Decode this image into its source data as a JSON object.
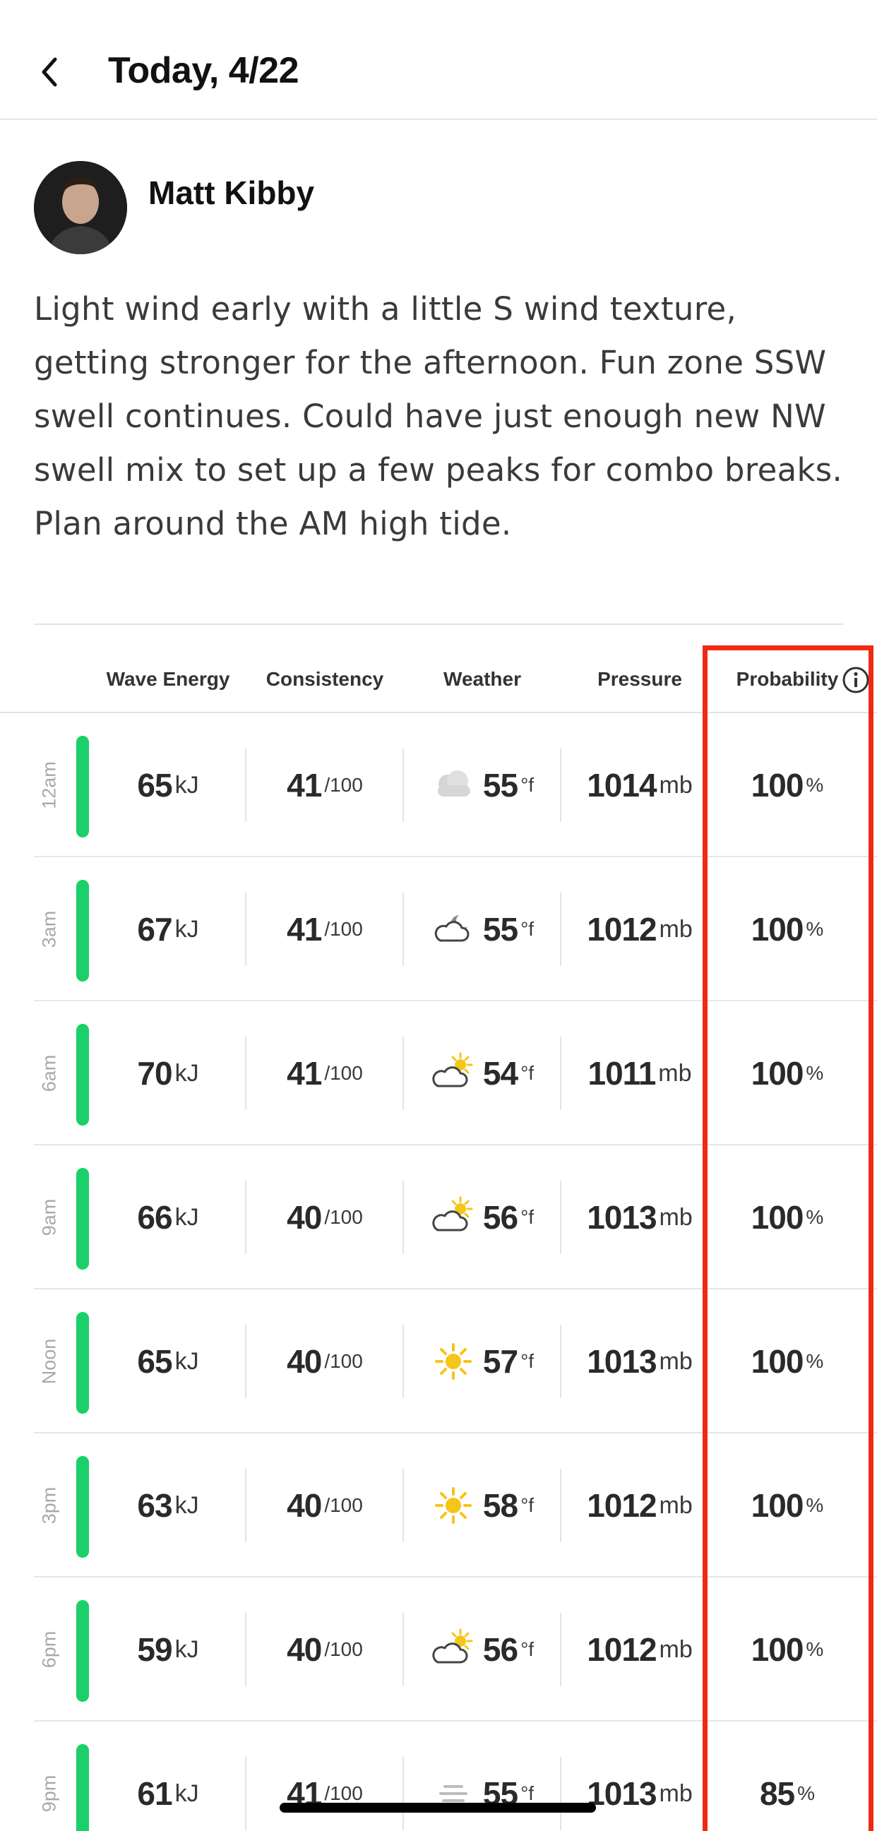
{
  "header": {
    "title": "Today, 4/22"
  },
  "author": {
    "name": "Matt Kibby"
  },
  "report": "Light wind early with a little S wind texture, getting stronger for the afternoon. Fun zone SSW swell continues. Could have just enough new NW swell mix to set up a few peaks for combo breaks. Plan around the AM high tide.",
  "columns": [
    "Wave Energy",
    "Consistency",
    "Weather",
    "Pressure",
    "Probability"
  ],
  "units": {
    "energy": "kJ",
    "consistency": "/100",
    "temp": "°f",
    "pressure": "mb",
    "probability": "%"
  },
  "rows": [
    {
      "time": "12am",
      "energy": "65",
      "consistency": "41",
      "weather_icon": "cloudy-icon",
      "temp": "55",
      "pressure": "1014",
      "probability": "100"
    },
    {
      "time": "3am",
      "energy": "67",
      "consistency": "41",
      "weather_icon": "partly-cloudy-night-icon",
      "temp": "55",
      "pressure": "1012",
      "probability": "100"
    },
    {
      "time": "6am",
      "energy": "70",
      "consistency": "41",
      "weather_icon": "partly-cloudy-day-icon",
      "temp": "54",
      "pressure": "1011",
      "probability": "100"
    },
    {
      "time": "9am",
      "energy": "66",
      "consistency": "40",
      "weather_icon": "partly-cloudy-day-icon",
      "temp": "56",
      "pressure": "1013",
      "probability": "100"
    },
    {
      "time": "Noon",
      "energy": "65",
      "consistency": "40",
      "weather_icon": "sunny-icon",
      "temp": "57",
      "pressure": "1013",
      "probability": "100"
    },
    {
      "time": "3pm",
      "energy": "63",
      "consistency": "40",
      "weather_icon": "sunny-icon",
      "temp": "58",
      "pressure": "1012",
      "probability": "100"
    },
    {
      "time": "6pm",
      "energy": "59",
      "consistency": "40",
      "weather_icon": "partly-cloudy-day-icon",
      "temp": "56",
      "pressure": "1012",
      "probability": "100"
    },
    {
      "time": "9pm",
      "energy": "61",
      "consistency": "41",
      "weather_icon": "fog-icon",
      "temp": "55",
      "pressure": "1013",
      "probability": "85"
    }
  ],
  "colors": {
    "accent_green": "#1bcf6b",
    "highlight_red": "#f02a12",
    "sun": "#f5c518"
  }
}
